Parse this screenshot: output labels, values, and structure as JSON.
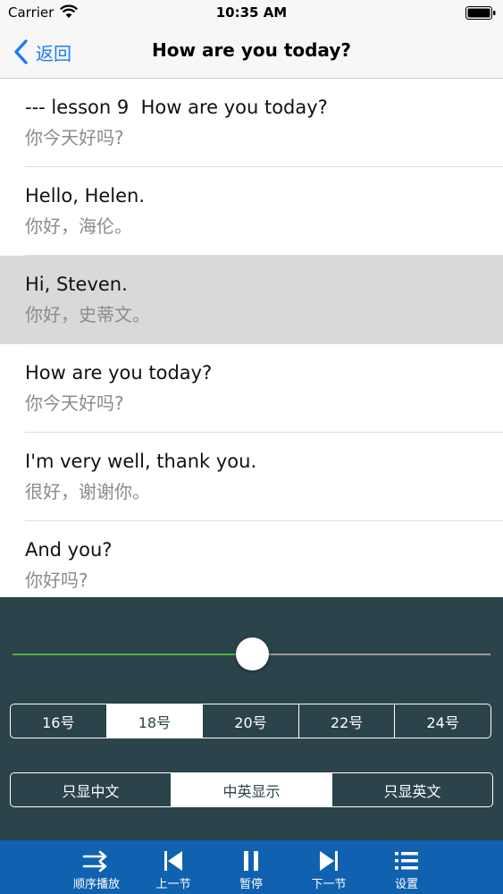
{
  "status_bar": {
    "carrier": "Carrier",
    "time": "10:35 AM"
  },
  "nav": {
    "back_label": "返回",
    "title": "How are you today?"
  },
  "lines": [
    {
      "en": "--- lesson 9  How are you today?",
      "zh": "你今天好吗?"
    },
    {
      "en": "Hello, Helen.",
      "zh": "你好，海伦。"
    },
    {
      "en": "Hi, Steven.",
      "zh": "你好，史蒂文。"
    },
    {
      "en": "How are you today?",
      "zh": "你今天好吗?"
    },
    {
      "en": "I'm very well, thank you.",
      "zh": "很好，谢谢你。"
    },
    {
      "en": "And you?",
      "zh": "你好吗?"
    }
  ],
  "selected_line_index": 2,
  "progress": {
    "value": 0.5
  },
  "font_size_options": [
    "16号",
    "18号",
    "20号",
    "22号",
    "24号"
  ],
  "font_size_selected_index": 1,
  "display_mode_options": [
    "只显中文",
    "中英显示",
    "只显英文"
  ],
  "display_mode_selected_index": 1,
  "tabs": [
    {
      "label": "顺序播放",
      "icon": "sequence-play-icon"
    },
    {
      "label": "上一节",
      "icon": "skip-previous-icon"
    },
    {
      "label": "暂停",
      "icon": "pause-icon"
    },
    {
      "label": "下一节",
      "icon": "skip-next-icon"
    },
    {
      "label": "设置",
      "icon": "list-settings-icon"
    }
  ],
  "colors": {
    "accent_blue": "#1a7ef0",
    "panel_bg": "#2b434b",
    "tab_bar_bg": "#1062b0",
    "progress_green": "#4fb33b",
    "selected_row_bg": "#d9d9dc"
  }
}
